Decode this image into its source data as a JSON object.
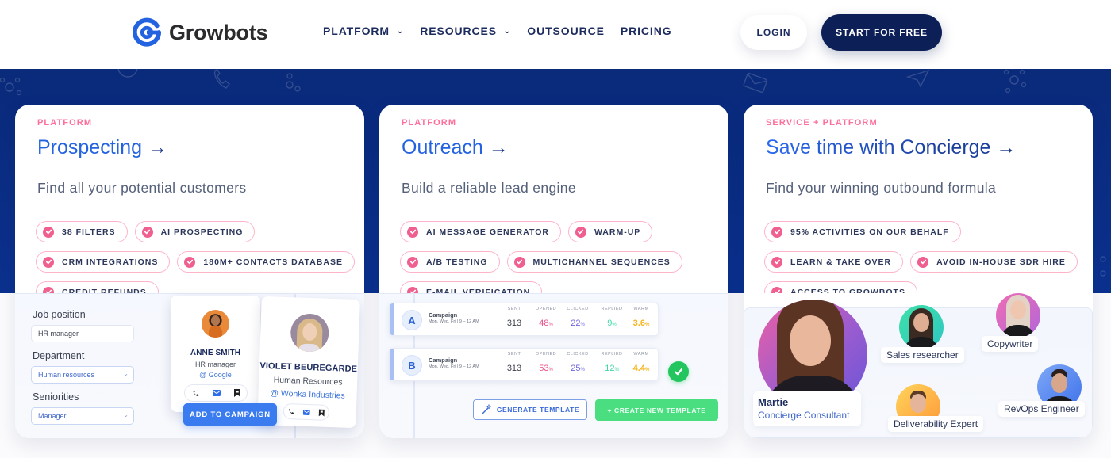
{
  "header": {
    "brand": "Growbots",
    "nav": [
      {
        "label": "PLATFORM",
        "has_dropdown": true
      },
      {
        "label": "RESOURCES",
        "has_dropdown": true
      },
      {
        "label": "OUTSOURCE",
        "has_dropdown": false
      },
      {
        "label": "PRICING",
        "has_dropdown": false
      }
    ],
    "login_label": "LOGIN",
    "start_label": "START FOR FREE"
  },
  "colors": {
    "brand_blue": "#2463e0",
    "navy": "#0d1f57",
    "band_blue": "#0b318f",
    "accent_pink": "#ff6f9b",
    "success_green": "#22c55e"
  },
  "cards": [
    {
      "eyebrow": "PLATFORM",
      "title": "Prospecting",
      "arrow": "→",
      "subtitle": "Find all your potential customers",
      "chips": [
        "38 FILTERS",
        "AI PROSPECTING",
        "CRM INTEGRATIONS",
        "180M+ CONTACTS DATABASE",
        "CREDIT REFUNDS"
      ],
      "demo": {
        "fields": [
          {
            "label": "Job position",
            "value": "HR manager",
            "type": "input"
          },
          {
            "label": "Department",
            "value": "Human resources",
            "type": "select"
          },
          {
            "label": "Seniorities",
            "value": "Manager",
            "type": "select"
          }
        ],
        "profiles": [
          {
            "name": "ANNE SMITH",
            "role": "HR manager",
            "company": "@ Google"
          },
          {
            "name": "VIOLET BEUREGARDE",
            "role": "Human Resources",
            "company": "@ Wonka Industries"
          }
        ],
        "add_button": "ADD TO CAMPAIGN"
      }
    },
    {
      "eyebrow": "PLATFORM",
      "title": "Outreach",
      "arrow": "→",
      "subtitle": "Build a reliable lead engine",
      "chips": [
        "AI MESSAGE GENERATOR",
        "WARM-UP",
        "A/B TESTING",
        "MULTICHANNEL SEQUENCES",
        "E-MAIL VERIFICATION"
      ],
      "demo": {
        "stat_labels": [
          "SENT",
          "OPENED",
          "CLICKED",
          "REPLIED",
          "WARM"
        ],
        "campaigns": [
          {
            "variant": "A",
            "name": "Campaign",
            "schedule": "Mon, Wed, Fri | 9 – 12 AM",
            "sent": "313",
            "opened": "48",
            "clicked": "22",
            "replied": "9",
            "warm": "3.6",
            "unit": "%"
          },
          {
            "variant": "B",
            "name": "Campaign",
            "schedule": "Mon, Wed, Fri | 9 – 12 AM",
            "sent": "313",
            "opened": "53",
            "clicked": "25",
            "replied": "12",
            "warm": "4.4",
            "unit": "%",
            "winner": true
          }
        ],
        "generate_button": "GENERATE TEMPLATE",
        "create_button": "+ CREATE NEW TEMPLATE"
      }
    },
    {
      "eyebrow": "SERVICE + PLATFORM",
      "title": "Save time with Concierge",
      "arrow": "→",
      "subtitle": "Find your winning outbound formula",
      "chips": [
        "95% ACTIVITIES ON OUR BEHALF",
        "LEARN & TAKE OVER",
        "AVOID IN-HOUSE SDR HIRE",
        "ACCESS TO GROWBOTS"
      ],
      "demo": {
        "lead": {
          "name": "Martie",
          "role": "Concierge Consultant"
        },
        "team": [
          "Sales researcher",
          "Copywriter",
          "Deliverability Expert",
          "RevOps Engineer"
        ]
      }
    }
  ]
}
